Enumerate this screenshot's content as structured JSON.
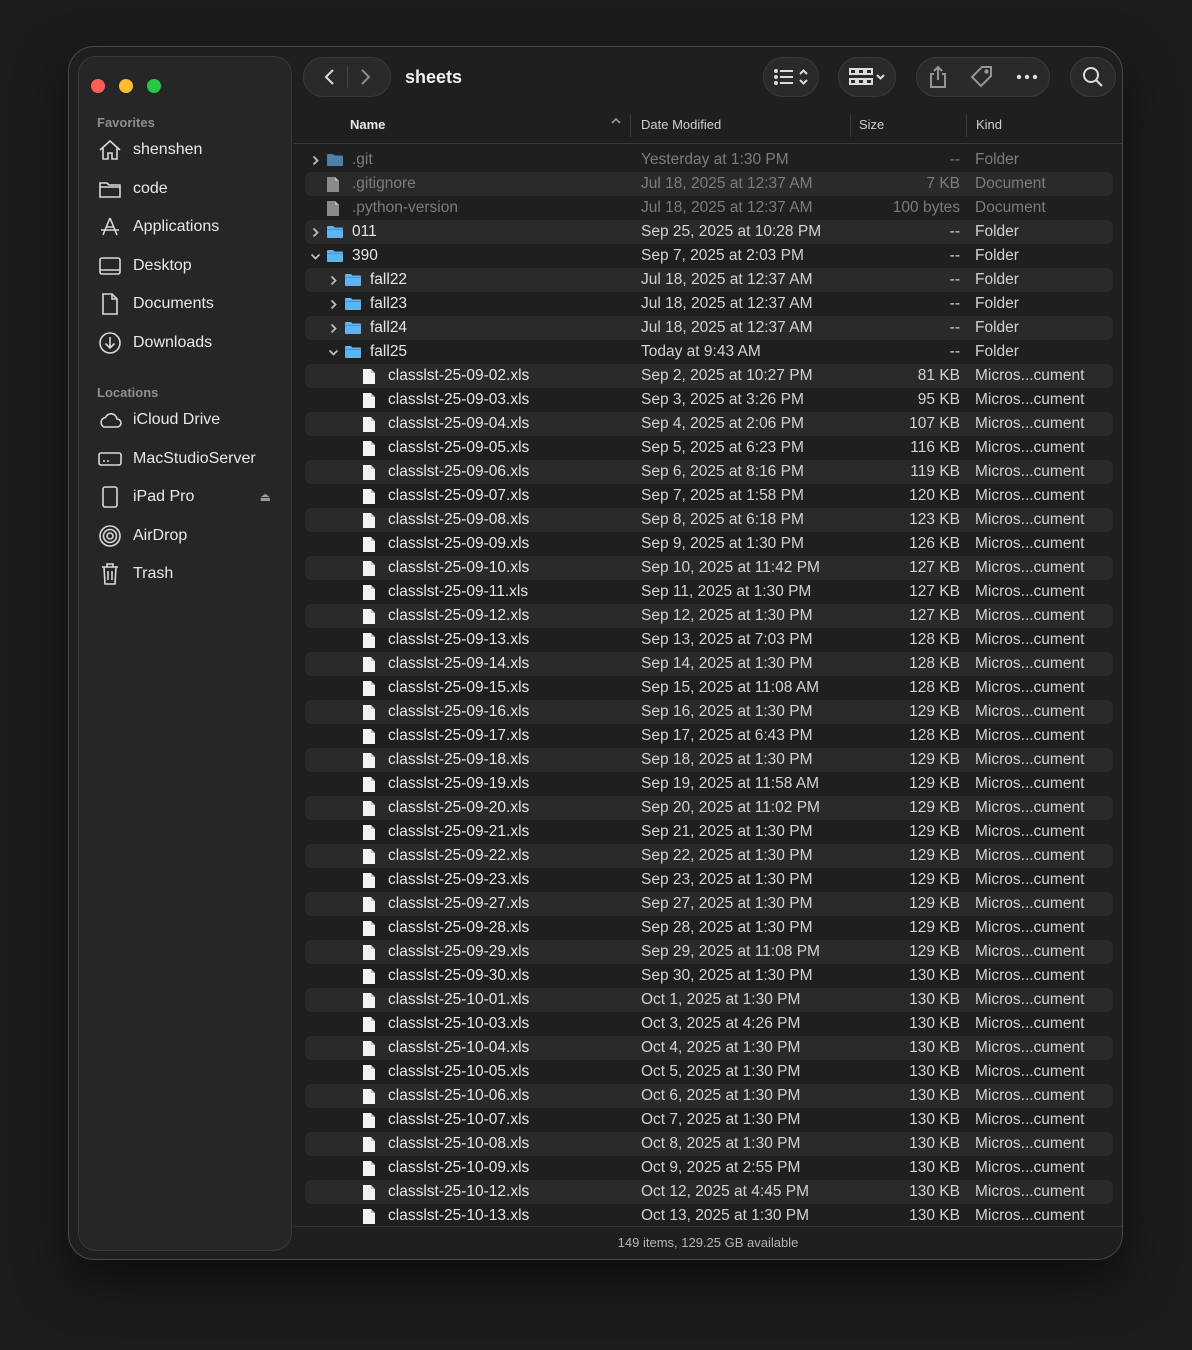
{
  "window": {
    "title": "sheets"
  },
  "sidebar": {
    "favorites_label": "Favorites",
    "favorites": [
      {
        "label": "shenshen",
        "icon": "home-icon"
      },
      {
        "label": "code",
        "icon": "folder-icon"
      },
      {
        "label": "Applications",
        "icon": "applications-icon"
      },
      {
        "label": "Desktop",
        "icon": "desktop-icon"
      },
      {
        "label": "Documents",
        "icon": "document-icon"
      },
      {
        "label": "Downloads",
        "icon": "download-icon"
      }
    ],
    "locations_label": "Locations",
    "locations": [
      {
        "label": "iCloud Drive",
        "icon": "cloud-icon"
      },
      {
        "label": "MacStudioServer",
        "icon": "server-icon"
      },
      {
        "label": "iPad Pro",
        "icon": "ipad-icon",
        "eject": "⏏"
      },
      {
        "label": "AirDrop",
        "icon": "airdrop-icon"
      },
      {
        "label": "Trash",
        "icon": "trash-icon"
      }
    ]
  },
  "columns": {
    "name": "Name",
    "date": "Date Modified",
    "size": "Size",
    "kind": "Kind"
  },
  "rows": [
    {
      "name": ".git",
      "date": "Yesterday at 1:30 PM",
      "size": "--",
      "kind": "Folder",
      "type": "folder",
      "depth": 0,
      "disc": "closed",
      "dim": true
    },
    {
      "name": ".gitignore",
      "date": "Jul 18, 2025 at 12:37 AM",
      "size": "7 KB",
      "kind": "Document",
      "type": "doc",
      "depth": 0,
      "disc": "none",
      "dim": true
    },
    {
      "name": ".python-version",
      "date": "Jul 18, 2025 at 12:37 AM",
      "size": "100 bytes",
      "kind": "Document",
      "type": "doc",
      "depth": 0,
      "disc": "none",
      "dim": true
    },
    {
      "name": "011",
      "date": "Sep 25, 2025 at 10:28 PM",
      "size": "--",
      "kind": "Folder",
      "type": "folder",
      "depth": 0,
      "disc": "closed"
    },
    {
      "name": "390",
      "date": "Sep 7, 2025 at 2:03 PM",
      "size": "--",
      "kind": "Folder",
      "type": "folder",
      "depth": 0,
      "disc": "open"
    },
    {
      "name": "fall22",
      "date": "Jul 18, 2025 at 12:37 AM",
      "size": "--",
      "kind": "Folder",
      "type": "folder",
      "depth": 1,
      "disc": "closed"
    },
    {
      "name": "fall23",
      "date": "Jul 18, 2025 at 12:37 AM",
      "size": "--",
      "kind": "Folder",
      "type": "folder",
      "depth": 1,
      "disc": "closed"
    },
    {
      "name": "fall24",
      "date": "Jul 18, 2025 at 12:37 AM",
      "size": "--",
      "kind": "Folder",
      "type": "folder",
      "depth": 1,
      "disc": "closed"
    },
    {
      "name": "fall25",
      "date": "Today at 9:43 AM",
      "size": "--",
      "kind": "Folder",
      "type": "folder",
      "depth": 1,
      "disc": "open"
    },
    {
      "name": "classlst-25-09-02.xls",
      "date": "Sep 2, 2025 at 10:27 PM",
      "size": "81 KB",
      "kind": "Micros...cument",
      "type": "file",
      "depth": 2,
      "disc": "none"
    },
    {
      "name": "classlst-25-09-03.xls",
      "date": "Sep 3, 2025 at 3:26 PM",
      "size": "95 KB",
      "kind": "Micros...cument",
      "type": "file",
      "depth": 2,
      "disc": "none"
    },
    {
      "name": "classlst-25-09-04.xls",
      "date": "Sep 4, 2025 at 2:06 PM",
      "size": "107 KB",
      "kind": "Micros...cument",
      "type": "file",
      "depth": 2,
      "disc": "none"
    },
    {
      "name": "classlst-25-09-05.xls",
      "date": "Sep 5, 2025 at 6:23 PM",
      "size": "116 KB",
      "kind": "Micros...cument",
      "type": "file",
      "depth": 2,
      "disc": "none"
    },
    {
      "name": "classlst-25-09-06.xls",
      "date": "Sep 6, 2025 at 8:16 PM",
      "size": "119 KB",
      "kind": "Micros...cument",
      "type": "file",
      "depth": 2,
      "disc": "none"
    },
    {
      "name": "classlst-25-09-07.xls",
      "date": "Sep 7, 2025 at 1:58 PM",
      "size": "120 KB",
      "kind": "Micros...cument",
      "type": "file",
      "depth": 2,
      "disc": "none"
    },
    {
      "name": "classlst-25-09-08.xls",
      "date": "Sep 8, 2025 at 6:18 PM",
      "size": "123 KB",
      "kind": "Micros...cument",
      "type": "file",
      "depth": 2,
      "disc": "none"
    },
    {
      "name": "classlst-25-09-09.xls",
      "date": "Sep 9, 2025 at 1:30 PM",
      "size": "126 KB",
      "kind": "Micros...cument",
      "type": "file",
      "depth": 2,
      "disc": "none"
    },
    {
      "name": "classlst-25-09-10.xls",
      "date": "Sep 10, 2025 at 11:42 PM",
      "size": "127 KB",
      "kind": "Micros...cument",
      "type": "file",
      "depth": 2,
      "disc": "none"
    },
    {
      "name": "classlst-25-09-11.xls",
      "date": "Sep 11, 2025 at 1:30 PM",
      "size": "127 KB",
      "kind": "Micros...cument",
      "type": "file",
      "depth": 2,
      "disc": "none"
    },
    {
      "name": "classlst-25-09-12.xls",
      "date": "Sep 12, 2025 at 1:30 PM",
      "size": "127 KB",
      "kind": "Micros...cument",
      "type": "file",
      "depth": 2,
      "disc": "none"
    },
    {
      "name": "classlst-25-09-13.xls",
      "date": "Sep 13, 2025 at 7:03 PM",
      "size": "128 KB",
      "kind": "Micros...cument",
      "type": "file",
      "depth": 2,
      "disc": "none"
    },
    {
      "name": "classlst-25-09-14.xls",
      "date": "Sep 14, 2025 at 1:30 PM",
      "size": "128 KB",
      "kind": "Micros...cument",
      "type": "file",
      "depth": 2,
      "disc": "none"
    },
    {
      "name": "classlst-25-09-15.xls",
      "date": "Sep 15, 2025 at 11:08 AM",
      "size": "128 KB",
      "kind": "Micros...cument",
      "type": "file",
      "depth": 2,
      "disc": "none"
    },
    {
      "name": "classlst-25-09-16.xls",
      "date": "Sep 16, 2025 at 1:30 PM",
      "size": "129 KB",
      "kind": "Micros...cument",
      "type": "file",
      "depth": 2,
      "disc": "none"
    },
    {
      "name": "classlst-25-09-17.xls",
      "date": "Sep 17, 2025 at 6:43 PM",
      "size": "128 KB",
      "kind": "Micros...cument",
      "type": "file",
      "depth": 2,
      "disc": "none"
    },
    {
      "name": "classlst-25-09-18.xls",
      "date": "Sep 18, 2025 at 1:30 PM",
      "size": "129 KB",
      "kind": "Micros...cument",
      "type": "file",
      "depth": 2,
      "disc": "none"
    },
    {
      "name": "classlst-25-09-19.xls",
      "date": "Sep 19, 2025 at 11:58 AM",
      "size": "129 KB",
      "kind": "Micros...cument",
      "type": "file",
      "depth": 2,
      "disc": "none"
    },
    {
      "name": "classlst-25-09-20.xls",
      "date": "Sep 20, 2025 at 11:02 PM",
      "size": "129 KB",
      "kind": "Micros...cument",
      "type": "file",
      "depth": 2,
      "disc": "none"
    },
    {
      "name": "classlst-25-09-21.xls",
      "date": "Sep 21, 2025 at 1:30 PM",
      "size": "129 KB",
      "kind": "Micros...cument",
      "type": "file",
      "depth": 2,
      "disc": "none"
    },
    {
      "name": "classlst-25-09-22.xls",
      "date": "Sep 22, 2025 at 1:30 PM",
      "size": "129 KB",
      "kind": "Micros...cument",
      "type": "file",
      "depth": 2,
      "disc": "none"
    },
    {
      "name": "classlst-25-09-23.xls",
      "date": "Sep 23, 2025 at 1:30 PM",
      "size": "129 KB",
      "kind": "Micros...cument",
      "type": "file",
      "depth": 2,
      "disc": "none"
    },
    {
      "name": "classlst-25-09-27.xls",
      "date": "Sep 27, 2025 at 1:30 PM",
      "size": "129 KB",
      "kind": "Micros...cument",
      "type": "file",
      "depth": 2,
      "disc": "none"
    },
    {
      "name": "classlst-25-09-28.xls",
      "date": "Sep 28, 2025 at 1:30 PM",
      "size": "129 KB",
      "kind": "Micros...cument",
      "type": "file",
      "depth": 2,
      "disc": "none"
    },
    {
      "name": "classlst-25-09-29.xls",
      "date": "Sep 29, 2025 at 11:08 PM",
      "size": "129 KB",
      "kind": "Micros...cument",
      "type": "file",
      "depth": 2,
      "disc": "none"
    },
    {
      "name": "classlst-25-09-30.xls",
      "date": "Sep 30, 2025 at 1:30 PM",
      "size": "130 KB",
      "kind": "Micros...cument",
      "type": "file",
      "depth": 2,
      "disc": "none"
    },
    {
      "name": "classlst-25-10-01.xls",
      "date": "Oct 1, 2025 at 1:30 PM",
      "size": "130 KB",
      "kind": "Micros...cument",
      "type": "file",
      "depth": 2,
      "disc": "none"
    },
    {
      "name": "classlst-25-10-03.xls",
      "date": "Oct 3, 2025 at 4:26 PM",
      "size": "130 KB",
      "kind": "Micros...cument",
      "type": "file",
      "depth": 2,
      "disc": "none"
    },
    {
      "name": "classlst-25-10-04.xls",
      "date": "Oct 4, 2025 at 1:30 PM",
      "size": "130 KB",
      "kind": "Micros...cument",
      "type": "file",
      "depth": 2,
      "disc": "none"
    },
    {
      "name": "classlst-25-10-05.xls",
      "date": "Oct 5, 2025 at 1:30 PM",
      "size": "130 KB",
      "kind": "Micros...cument",
      "type": "file",
      "depth": 2,
      "disc": "none"
    },
    {
      "name": "classlst-25-10-06.xls",
      "date": "Oct 6, 2025 at 1:30 PM",
      "size": "130 KB",
      "kind": "Micros...cument",
      "type": "file",
      "depth": 2,
      "disc": "none"
    },
    {
      "name": "classlst-25-10-07.xls",
      "date": "Oct 7, 2025 at 1:30 PM",
      "size": "130 KB",
      "kind": "Micros...cument",
      "type": "file",
      "depth": 2,
      "disc": "none"
    },
    {
      "name": "classlst-25-10-08.xls",
      "date": "Oct 8, 2025 at 1:30 PM",
      "size": "130 KB",
      "kind": "Micros...cument",
      "type": "file",
      "depth": 2,
      "disc": "none"
    },
    {
      "name": "classlst-25-10-09.xls",
      "date": "Oct 9, 2025 at 2:55 PM",
      "size": "130 KB",
      "kind": "Micros...cument",
      "type": "file",
      "depth": 2,
      "disc": "none"
    },
    {
      "name": "classlst-25-10-12.xls",
      "date": "Oct 12, 2025 at 4:45 PM",
      "size": "130 KB",
      "kind": "Micros...cument",
      "type": "file",
      "depth": 2,
      "disc": "none"
    },
    {
      "name": "classlst-25-10-13.xls",
      "date": "Oct 13, 2025 at 1:30 PM",
      "size": "130 KB",
      "kind": "Micros...cument",
      "type": "file",
      "depth": 2,
      "disc": "none"
    }
  ],
  "status": "149 items, 129.25 GB available",
  "colors": {
    "folder": "#5fb4f0",
    "file": "#f2f2f2",
    "close": "#ff5f57",
    "minimize": "#febc2e",
    "zoom": "#28c840"
  }
}
